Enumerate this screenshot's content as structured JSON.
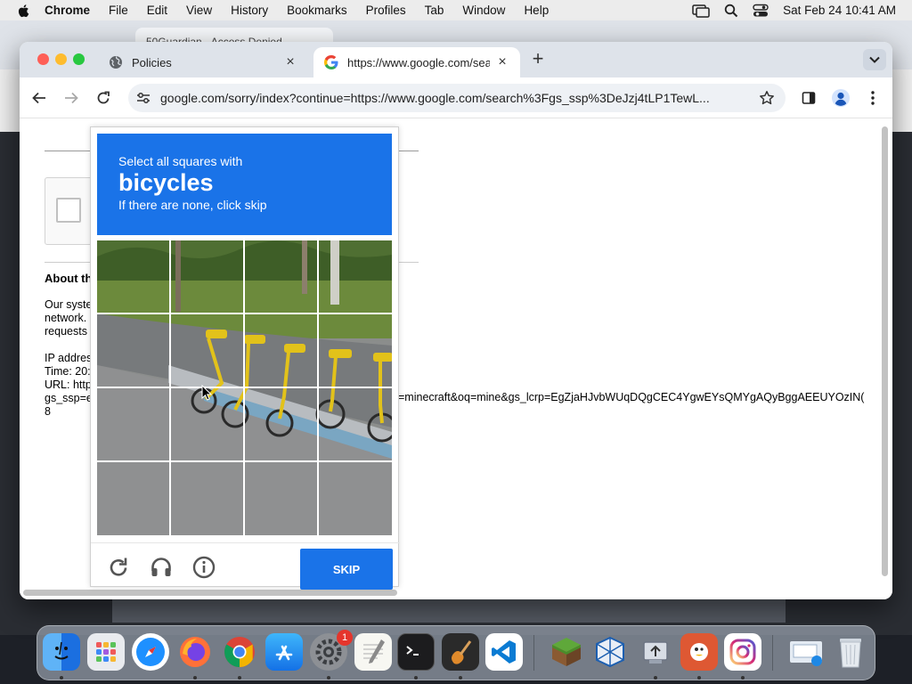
{
  "menubar": {
    "app_name": "Chrome",
    "items": [
      "File",
      "Edit",
      "View",
      "History",
      "Bookmarks",
      "Profiles",
      "Tab",
      "Window",
      "Help"
    ],
    "datetime": "Sat Feb 24  10:41 AM"
  },
  "background_window": {
    "tab_title": "50Guardian - Access Denied"
  },
  "browser": {
    "tabs": [
      {
        "title": "Policies",
        "active": false
      },
      {
        "title": "https://www.google.com/sear",
        "active": true
      }
    ],
    "url": "google.com/sorry/index?continue=https://www.google.com/search%3Fgs_ssp%3DeJzj4tLP1TewL..."
  },
  "page": {
    "about_title": "About th",
    "about_lines": [
      "Our syste",
      "network.",
      "requests"
    ],
    "ip_lines": [
      "IP addres",
      "Time: 20:",
      "URL: http",
      "gs_ssp=e",
      "8"
    ],
    "url_tail": "=minecraft&oq=mine&gs_lcrp=EgZjaHJvbWUqDQgCEC4YgwEYsQMYgAQyBggAEEUYOzIN("
  },
  "captcha": {
    "instruction": "Select all squares with",
    "target": "bicycles",
    "hint": "If there are none, click skip",
    "skip_label": "SKIP",
    "grid": {
      "rows": 4,
      "cols": 4
    }
  },
  "dock": {
    "apps": [
      {
        "name": "Finder",
        "icon": "finder-icon",
        "running": true
      },
      {
        "name": "Launchpad",
        "icon": "launchpad-icon",
        "running": false
      },
      {
        "name": "Safari",
        "icon": "safari-icon",
        "running": false
      },
      {
        "name": "Firefox",
        "icon": "firefox-icon",
        "running": true
      },
      {
        "name": "Chrome",
        "icon": "chrome-icon",
        "running": true
      },
      {
        "name": "App Store",
        "icon": "app-store-icon",
        "running": false
      },
      {
        "name": "System Settings",
        "icon": "settings-icon",
        "running": true,
        "badge": "1"
      },
      {
        "name": "TextEdit",
        "icon": "textedit-icon",
        "running": false
      },
      {
        "name": "Terminal",
        "icon": "terminal-icon",
        "running": true
      },
      {
        "name": "GarageBand",
        "icon": "garageband-icon",
        "running": true
      },
      {
        "name": "VS Code",
        "icon": "vscode-icon",
        "running": false
      },
      {
        "name": "Minecraft",
        "icon": "minecraft-icon",
        "running": false
      },
      {
        "name": "VirtualBox",
        "icon": "virtualbox-icon",
        "running": false
      },
      {
        "name": "Migration Assistant",
        "icon": "migration-icon",
        "running": true
      },
      {
        "name": "DuckDuckGo",
        "icon": "duckduckgo-icon",
        "running": true
      },
      {
        "name": "Instagram",
        "icon": "instagram-icon",
        "running": true
      },
      {
        "name": "Downloads",
        "icon": "downloads-folder-icon",
        "running": false
      },
      {
        "name": "Trash",
        "icon": "trash-icon",
        "running": false
      }
    ]
  },
  "colors": {
    "captcha_blue": "#1a73e8",
    "tabstrip": "#dee3ea"
  }
}
